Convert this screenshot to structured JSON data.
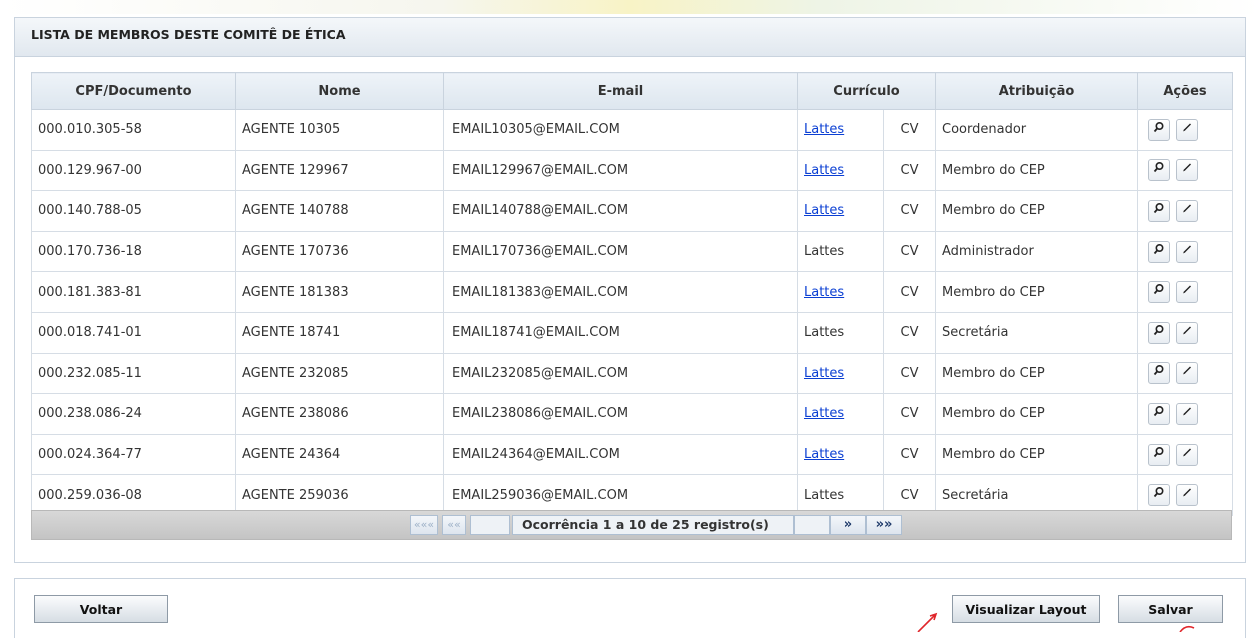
{
  "panel": {
    "title": "LISTA DE MEMBROS DESTE COMITÊ DE ÉTICA"
  },
  "columns": {
    "cpf": "CPF/Documento",
    "nome": "Nome",
    "email": "E-mail",
    "curriculo": "Currículo",
    "atribuicao": "Atribuição",
    "acoes": "Ações"
  },
  "rows": [
    {
      "cpf": "000.010.305-58",
      "nome": "AGENTE 10305",
      "email": "EMAIL10305@EMAIL.COM",
      "lattes": "Lattes",
      "lattes_link": true,
      "cv": "CV",
      "atribuicao": "Coordenador"
    },
    {
      "cpf": "000.129.967-00",
      "nome": "AGENTE 129967",
      "email": "EMAIL129967@EMAIL.COM",
      "lattes": "Lattes",
      "lattes_link": true,
      "cv": "CV",
      "atribuicao": "Membro do CEP"
    },
    {
      "cpf": "000.140.788-05",
      "nome": "AGENTE 140788",
      "email": "EMAIL140788@EMAIL.COM",
      "lattes": "Lattes",
      "lattes_link": true,
      "cv": "CV",
      "atribuicao": "Membro do CEP"
    },
    {
      "cpf": "000.170.736-18",
      "nome": "AGENTE 170736",
      "email": "EMAIL170736@EMAIL.COM",
      "lattes": "Lattes",
      "lattes_link": false,
      "cv": "CV",
      "atribuicao": "Administrador"
    },
    {
      "cpf": "000.181.383-81",
      "nome": "AGENTE 181383",
      "email": "EMAIL181383@EMAIL.COM",
      "lattes": "Lattes",
      "lattes_link": true,
      "cv": "CV",
      "atribuicao": "Membro do CEP"
    },
    {
      "cpf": "000.018.741-01",
      "nome": "AGENTE 18741",
      "email": "EMAIL18741@EMAIL.COM",
      "lattes": "Lattes",
      "lattes_link": false,
      "cv": "CV",
      "atribuicao": "Secretária"
    },
    {
      "cpf": "000.232.085-11",
      "nome": "AGENTE 232085",
      "email": "EMAIL232085@EMAIL.COM",
      "lattes": "Lattes",
      "lattes_link": true,
      "cv": "CV",
      "atribuicao": "Membro do CEP"
    },
    {
      "cpf": "000.238.086-24",
      "nome": "AGENTE 238086",
      "email": "EMAIL238086@EMAIL.COM",
      "lattes": "Lattes",
      "lattes_link": true,
      "cv": "CV",
      "atribuicao": "Membro do CEP"
    },
    {
      "cpf": "000.024.364-77",
      "nome": "AGENTE 24364",
      "email": "EMAIL24364@EMAIL.COM",
      "lattes": "Lattes",
      "lattes_link": true,
      "cv": "CV",
      "atribuicao": "Membro do CEP"
    },
    {
      "cpf": "000.259.036-08",
      "nome": "AGENTE 259036",
      "email": "EMAIL259036@EMAIL.COM",
      "lattes": "Lattes",
      "lattes_link": false,
      "cv": "CV",
      "atribuicao": "Secretária"
    }
  ],
  "row_actions": {
    "view_icon": "magnifier-icon",
    "edit_icon": "pencil-icon"
  },
  "pagination": {
    "first": "«««",
    "prev": "««",
    "info": "Ocorrência 1 a 10 de 25 registro(s)",
    "next": "»",
    "last": "»»"
  },
  "buttons": {
    "back": "Voltar",
    "preview_layout": "Visualizar Layout",
    "save": "Salvar"
  },
  "colors": {
    "link": "#0b3fd3",
    "annotation_arrow": "#e0262b",
    "header_bg": "#e1e8ef",
    "pager_bg": "#c4c4c4"
  }
}
